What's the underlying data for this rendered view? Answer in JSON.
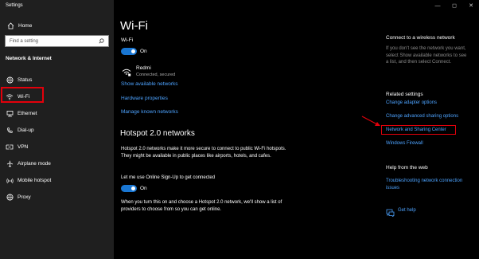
{
  "window": {
    "title": "Settings",
    "minimize_glyph": "—",
    "maximize_glyph": "◻",
    "close_glyph": "✕"
  },
  "sidebar": {
    "home_label": "Home",
    "search_placeholder": "Find a setting",
    "section_header": "Network & Internet",
    "items": [
      {
        "label": "Status",
        "icon": "status-globe-icon"
      },
      {
        "label": "Wi-Fi",
        "icon": "wifi-icon"
      },
      {
        "label": "Ethernet",
        "icon": "ethernet-icon"
      },
      {
        "label": "Dial-up",
        "icon": "dialup-icon"
      },
      {
        "label": "VPN",
        "icon": "vpn-icon"
      },
      {
        "label": "Airplane mode",
        "icon": "airplane-icon"
      },
      {
        "label": "Mobile hotspot",
        "icon": "mobile-hotspot-icon"
      },
      {
        "label": "Proxy",
        "icon": "proxy-globe-icon"
      }
    ],
    "selected": "Wi-Fi"
  },
  "main": {
    "title": "Wi-Fi",
    "wifi_label": "Wi-Fi",
    "wifi_toggle_state": "On",
    "network_name": "Redmi",
    "network_status": "Connected, secured",
    "links": {
      "show_available": "Show available networks",
      "hardware_properties": "Hardware properties",
      "manage_known": "Manage known networks"
    },
    "hotspot_heading": "Hotspot 2.0 networks",
    "hotspot_desc": "Hotspot 2.0 networks make it more secure to connect to public Wi-Fi hotspots. They might be available in public places like airports, hotels, and cafes.",
    "online_signup_label": "Let me use Online Sign-Up to get connected",
    "online_signup_state": "On",
    "footer_text": "When you turn this on and choose a Hotspot 2.0 network, we'll show a list of providers to choose from so you can get online."
  },
  "right_panel": {
    "connect_heading": "Connect to a wireless network",
    "connect_desc": "If you don't see the network you want, select Show available networks to see a list, and then select Connect.",
    "related_heading": "Related settings",
    "related_links": [
      "Change adapter options",
      "Change advanced sharing options",
      "Network and Sharing Center",
      "Windows Firewall"
    ],
    "help_heading": "Help from the web",
    "help_link": "Troubleshooting network connection issues",
    "get_help": "Get help"
  },
  "colors": {
    "accent": "#1976d2",
    "link": "#4da3ff",
    "highlight": "#e3000b",
    "sidebar_bg": "#1f1f1f"
  }
}
